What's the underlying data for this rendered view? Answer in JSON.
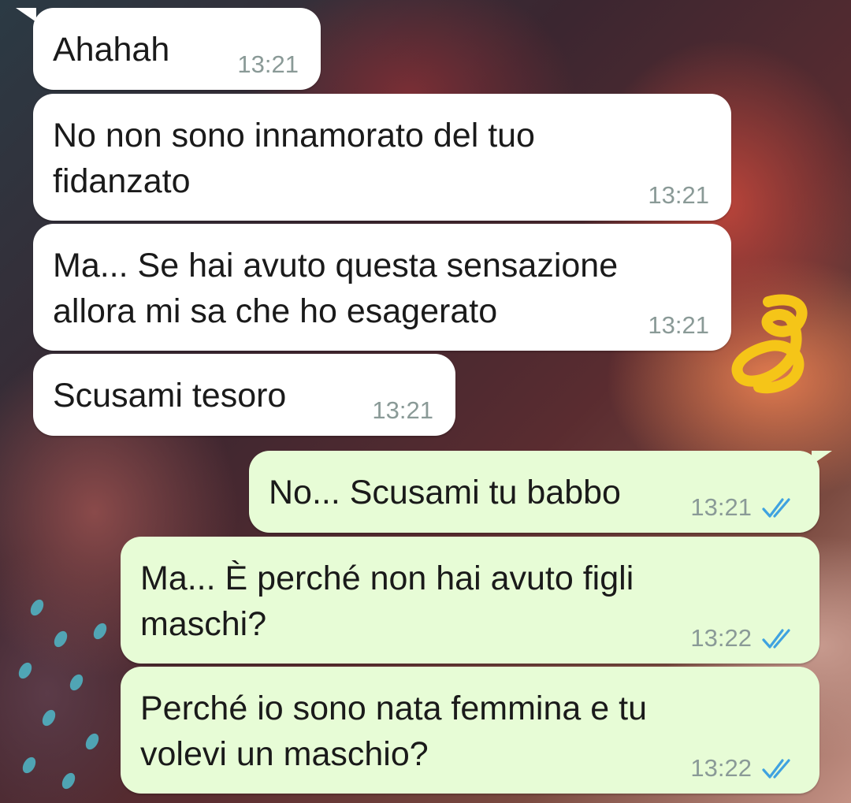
{
  "messages": [
    {
      "direction": "in",
      "text": "Ahahah",
      "time": "13:21"
    },
    {
      "direction": "in",
      "text": "No non sono innamorato del tuo\nfidanzato",
      "time": "13:21"
    },
    {
      "direction": "in",
      "text": "Ma... Se hai avuto questa sensazione\nallora mi sa che ho esagerato",
      "time": "13:21"
    },
    {
      "direction": "in",
      "text": "Scusami tesoro",
      "time": "13:21"
    },
    {
      "direction": "out",
      "text": "No... Scusami tu babbo",
      "time": "13:21",
      "status": "read-ticks-icon"
    },
    {
      "direction": "out",
      "text": "Ma... È perché non hai avuto figli\nmaschi?",
      "time": "13:22",
      "status": "read-ticks-icon"
    },
    {
      "direction": "out",
      "text": "Perché io sono nata femmina e tu\nvolevi un maschio?",
      "time": "13:22",
      "status": "read-ticks-icon"
    }
  ],
  "colors": {
    "incoming_bubble": "#ffffff",
    "outgoing_bubble": "#e7fcd6",
    "read_ticks": "#3fa2e0",
    "annotation": "#f5c518"
  },
  "annotation": {
    "icon": "handwritten-number-8-scribble"
  }
}
